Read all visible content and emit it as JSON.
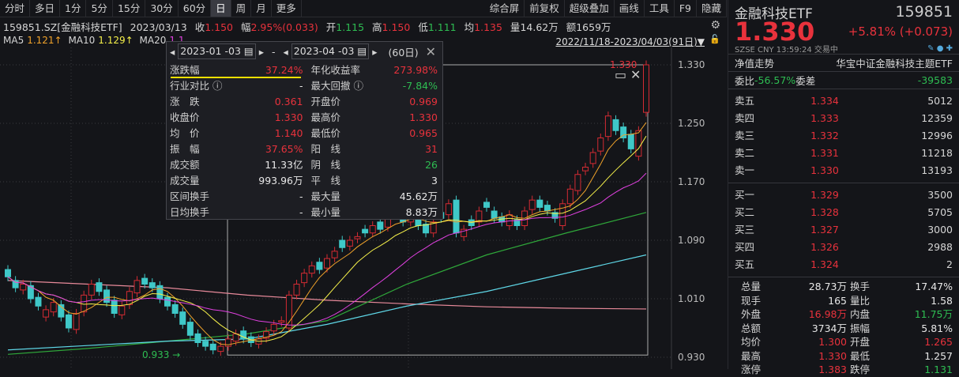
{
  "tabs": [
    "分时",
    "多日",
    "1分",
    "5分",
    "15分",
    "30分",
    "60分",
    "日",
    "周",
    "月",
    "更多"
  ],
  "active_tab": "日",
  "right_tabs": [
    "综合屏",
    "前复权",
    "超级叠加",
    "画线",
    "工具",
    "F9",
    "隐藏"
  ],
  "info": {
    "symbol": "159851.SZ[金融科技ETF]",
    "date": "2023/03/13",
    "close_label": "收",
    "close": "1.150",
    "change_label": "幅",
    "change": "2.95%(0.033)",
    "open_label": "开",
    "open": "1.115",
    "high_label": "高",
    "high": "1.150",
    "low_label": "低",
    "low": "1.111",
    "avg_label": "均",
    "avg": "1.135",
    "vol_label": "量",
    "vol": "14.62万",
    "amt_label": "额",
    "amt": "1659万"
  },
  "ma_legend": {
    "ma5_label": "MA5",
    "ma5": "1.121↑",
    "ma10_label": "MA10",
    "ma10": "1.129↑",
    "ma20_label": "MA20",
    "ma20": "1.1"
  },
  "range_text": "2022/11/18-2023/04/03(91日)▼",
  "popup": {
    "start": "2023-01 -03",
    "sep": "-",
    "end": "2023-04 -03",
    "days": "(60日)",
    "rows": [
      [
        "涨跌幅",
        "37.24%",
        "red",
        "年化收益率",
        "273.98%",
        "red"
      ],
      [
        "行业对比 ⓘ",
        "-",
        "white",
        "最大回撤 ⓘ",
        "-7.84%",
        "green"
      ],
      [
        "涨　跌",
        "0.361",
        "red",
        "开盘价",
        "0.969",
        "red"
      ],
      [
        "收盘价",
        "1.330",
        "red",
        "最高价",
        "1.330",
        "red"
      ],
      [
        "均　价",
        "1.140",
        "red",
        "最低价",
        "0.965",
        "red"
      ],
      [
        "振　幅",
        "37.65%",
        "red",
        "阳　线",
        "31",
        "red"
      ],
      [
        "成交额",
        "11.33亿",
        "white",
        "阴　线",
        "26",
        "green"
      ],
      [
        "成交量",
        "993.96万",
        "white",
        "平　线",
        "3",
        "white"
      ],
      [
        "区间换手",
        "-",
        "white",
        "最大量",
        "45.62万",
        "white"
      ],
      [
        "日均换手",
        "-",
        "white",
        "最小量",
        "8.83万",
        "white"
      ]
    ]
  },
  "chart_data": {
    "type": "candlestick",
    "ylim": [
      0.915,
      1.345
    ],
    "y_ticks": [
      "1.330",
      "1.250",
      "1.170",
      "1.090",
      "1.010",
      "0.930"
    ],
    "low_marker": "0.933",
    "high_marker": "1.330",
    "open": [
      1.05,
      1.035,
      1.022,
      1.028,
      1.012,
      0.985,
      0.992,
      1.002,
      0.988,
      0.968,
      0.992,
      1.015,
      1.032,
      1.022,
      1.008,
      0.988,
      1.002,
      1.018,
      1.038,
      1.032,
      1.028,
      1.012,
      1.002,
      0.992,
      0.978,
      0.962,
      0.952,
      0.948,
      0.938,
      0.945,
      0.952,
      0.966,
      0.958,
      0.948,
      0.956,
      0.966,
      0.978,
      0.97,
      1.015,
      1.032,
      1.045,
      1.06,
      1.052,
      1.066,
      1.09,
      1.082,
      1.092,
      1.105,
      1.1,
      1.115,
      1.108,
      1.132,
      1.128,
      1.115,
      1.125,
      1.112,
      1.1,
      1.128,
      1.125,
      1.145,
      1.095,
      1.118,
      1.115,
      1.142,
      1.13,
      1.122,
      1.11,
      1.118,
      1.11,
      1.132,
      1.145,
      1.138,
      1.128,
      1.11,
      1.14,
      1.158,
      1.185,
      1.195,
      1.212,
      1.232,
      1.255,
      1.245,
      1.235,
      1.205,
      1.265
    ],
    "close": [
      1.04,
      1.025,
      1.03,
      1.01,
      1.0,
      0.995,
      1.005,
      0.985,
      0.97,
      0.99,
      1.015,
      1.03,
      1.02,
      1.005,
      0.99,
      1.0,
      1.02,
      1.035,
      1.03,
      1.025,
      1.01,
      1.0,
      0.99,
      0.975,
      0.96,
      0.95,
      0.945,
      0.94,
      0.945,
      0.955,
      0.962,
      0.955,
      0.95,
      0.955,
      0.965,
      0.975,
      0.98,
      1.015,
      1.03,
      1.045,
      1.055,
      1.05,
      1.065,
      1.075,
      1.08,
      1.09,
      1.095,
      1.1,
      1.11,
      1.105,
      1.12,
      1.125,
      1.115,
      1.13,
      1.11,
      1.1,
      1.115,
      1.12,
      1.14,
      1.1,
      1.105,
      1.11,
      1.13,
      1.135,
      1.12,
      1.115,
      1.125,
      1.11,
      1.13,
      1.145,
      1.135,
      1.13,
      1.12,
      1.14,
      1.16,
      1.18,
      1.19,
      1.21,
      1.23,
      1.26,
      1.24,
      1.23,
      1.215,
      1.24,
      1.33
    ],
    "long_ma": [
      {
        "name": "pink",
        "color": "#e88a9a",
        "values": [
          1.035,
          1.03,
          1.025,
          1.015,
          1.008,
          1.003,
          0.999,
          0.997,
          0.996
        ]
      },
      {
        "name": "green",
        "color": "#2fa83a",
        "values": [
          0.934,
          0.942,
          0.952,
          0.962,
          0.98,
          1.03,
          1.07,
          1.1,
          1.128
        ]
      },
      {
        "name": "cyan",
        "color": "#5fd8e8",
        "values": [
          0.94,
          0.946,
          0.952,
          0.955,
          0.975,
          1.0,
          1.02,
          1.045,
          1.07
        ]
      }
    ]
  },
  "quote": {
    "name": "金融科技ETF",
    "code": "159851",
    "price": "1.330",
    "change": "+5.81% (+0.073)",
    "meta": "SZSE  CNY  13:59:24  交易中",
    "nav_label": "净值走势",
    "fund_name": "华宝中证金融科技主题ETF",
    "wb_label": "委比",
    "wb": "-56.57%",
    "wc_label": "委差",
    "wc": "-39583",
    "asks": [
      [
        "卖五",
        "1.334",
        "5012"
      ],
      [
        "卖四",
        "1.333",
        "12359"
      ],
      [
        "卖三",
        "1.332",
        "12996"
      ],
      [
        "卖二",
        "1.331",
        "11218"
      ],
      [
        "卖一",
        "1.330",
        "13193"
      ]
    ],
    "bids": [
      [
        "买一",
        "1.329",
        "3500"
      ],
      [
        "买二",
        "1.328",
        "5705"
      ],
      [
        "买三",
        "1.327",
        "3000"
      ],
      [
        "买四",
        "1.326",
        "2988"
      ],
      [
        "买五",
        "1.324",
        "2"
      ]
    ],
    "stats": [
      [
        "总量",
        "28.73万",
        "white",
        "换手",
        "17.47%",
        "white"
      ],
      [
        "现手",
        "165",
        "white",
        "量比",
        "1.58",
        "white"
      ],
      [
        "外盘",
        "16.98万",
        "red",
        "内盘",
        "11.75万",
        "green"
      ],
      [
        "总额",
        "3734万",
        "white",
        "振幅",
        "5.81%",
        "white"
      ],
      [
        "均价",
        "1.300",
        "red",
        "开盘",
        "1.265",
        "red"
      ],
      [
        "最高",
        "1.330",
        "red",
        "最低",
        "1.257",
        "white"
      ],
      [
        "涨停",
        "1.383",
        "red",
        "跌停",
        "1.131",
        "green"
      ]
    ]
  }
}
